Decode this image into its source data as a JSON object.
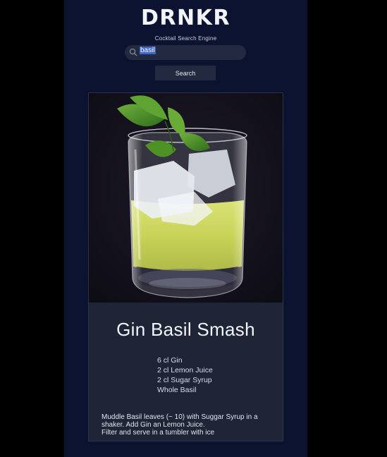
{
  "app": {
    "logo": "DRNKR",
    "tagline": "Cocktail Search Engine",
    "search": {
      "value": "basil",
      "button_label": "Search",
      "icon": "search-icon"
    }
  },
  "result": {
    "title": "Gin Basil Smash",
    "ingredients": [
      "6 cl Gin",
      "2 cl Lemon Juice",
      "2 cl Sugar Syrup",
      "Whole Basil"
    ],
    "instructions": [
      "Muddle Basil leaves (~ 10) with Suggar Syrup in a",
      "shaker. Add Gin an Lemon Juice.",
      "Filter and serve in a tumbler with ice"
    ]
  },
  "colors": {
    "page_background": "#0c1330",
    "card_background": "#1f2537",
    "input_background": "#232a40",
    "selection": "#3f66c7"
  }
}
